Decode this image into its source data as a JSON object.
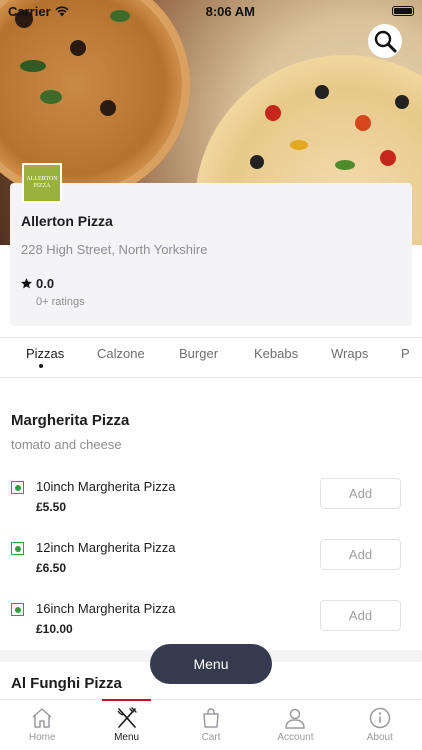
{
  "status_bar": {
    "carrier": "Carrier",
    "time": "8:06 AM"
  },
  "store": {
    "logo_text": "ALLERTON PIZZA",
    "name": "Allerton Pizza",
    "address": "228 High Street, North Yorkshire",
    "rating": "0.0",
    "rating_count": "0+ ratings"
  },
  "categories": [
    "Pizzas",
    "Calzone",
    "Burger",
    "Kebabs",
    "Wraps",
    "P"
  ],
  "selected_category": "Pizzas",
  "sections": [
    {
      "title": "Margherita Pizza",
      "description": "tomato and cheese",
      "items": [
        {
          "name": "10inch Margherita Pizza",
          "price": "£5.50",
          "add_label": "Add"
        },
        {
          "name": "12inch Margherita Pizza",
          "price": "£6.50",
          "add_label": "Add"
        },
        {
          "name": "16inch Margherita Pizza",
          "price": "£10.00",
          "add_label": "Add"
        }
      ]
    },
    {
      "title": "Al Funghi Pizza"
    }
  ],
  "floating_menu_label": "Menu",
  "tabs": [
    {
      "label": "Home",
      "icon": "home-icon"
    },
    {
      "label": "Menu",
      "icon": "fork-knife-icon"
    },
    {
      "label": "Cart",
      "icon": "bag-icon"
    },
    {
      "label": "Account",
      "icon": "user-icon"
    },
    {
      "label": "About",
      "icon": "info-icon"
    }
  ],
  "active_tab": "Menu",
  "colors": {
    "accent": "#c8102e",
    "veg_green": "#2e9e3e",
    "floating_button": "#353a4e",
    "logo_green": "#9ab13c"
  }
}
